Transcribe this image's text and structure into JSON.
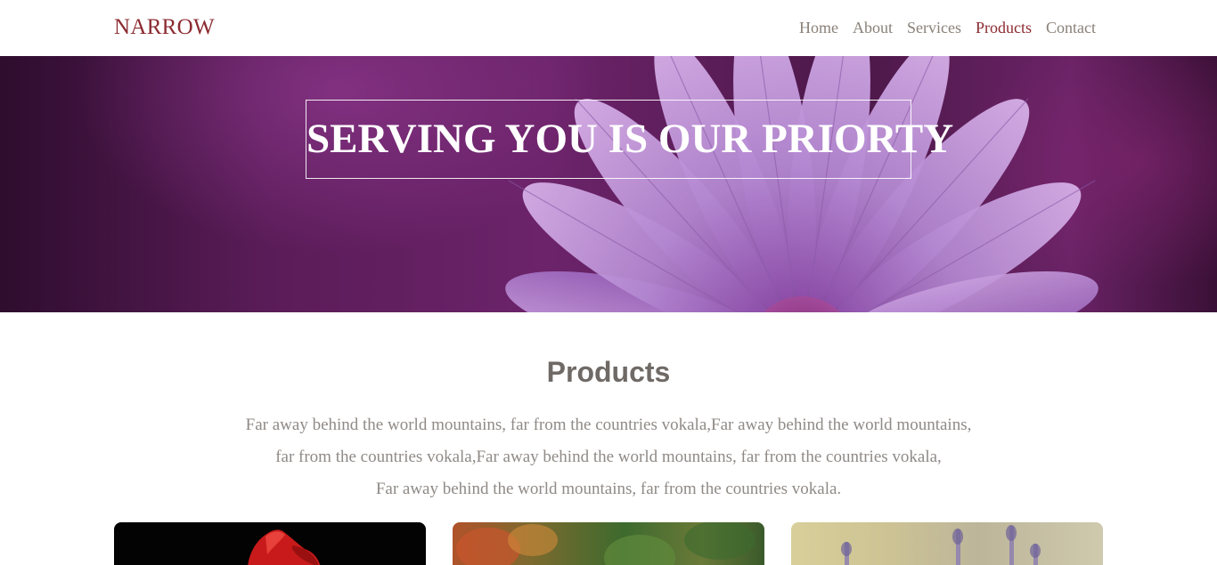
{
  "header": {
    "brand": "NARROW",
    "nav": [
      {
        "label": "Home",
        "active": false
      },
      {
        "label": "About",
        "active": false
      },
      {
        "label": "Services",
        "active": false
      },
      {
        "label": "Products",
        "active": true
      },
      {
        "label": "Contact",
        "active": false
      }
    ]
  },
  "hero": {
    "title": "SERVING YOU IS OUR PRIORTY"
  },
  "products": {
    "heading": "Products",
    "description_lines": [
      "Far away behind the world mountains, far from the countries vokala,Far away behind the world mountains,",
      "far from the countries vokala,Far away behind the world mountains, far from the countries vokala,",
      "Far away behind the world mountains, far from the countries vokala."
    ]
  },
  "colors": {
    "brand": "#8b2a30",
    "nav_text": "#8a8178",
    "heading": "#6f6a66",
    "body_text": "#8f8a86",
    "hero_bg": "#5a1c58"
  }
}
